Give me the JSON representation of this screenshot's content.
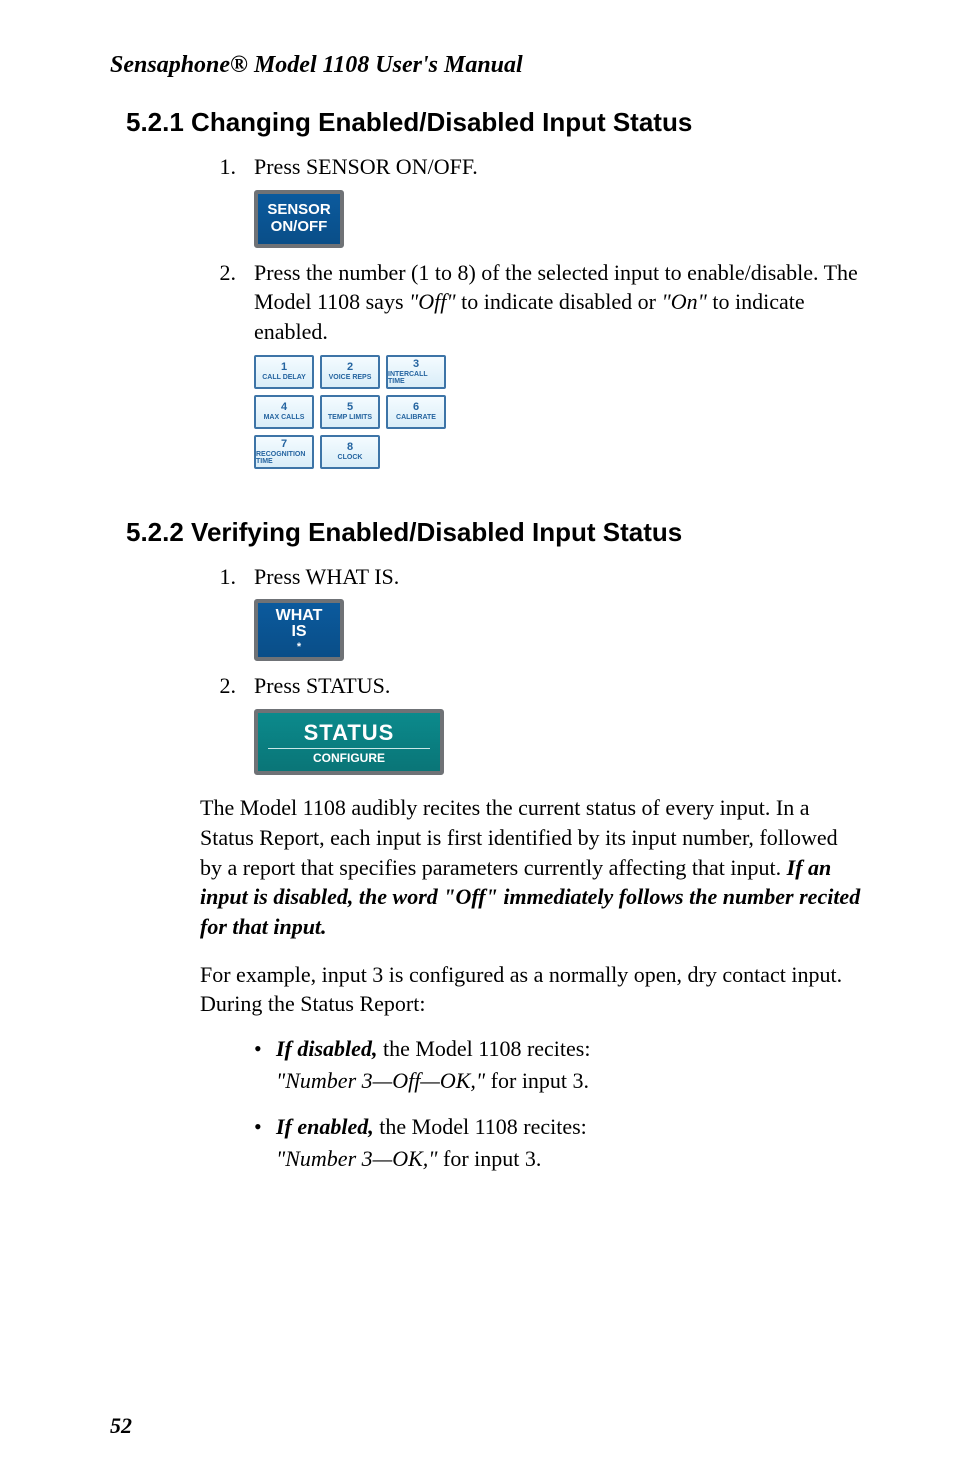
{
  "header": "Sensaphone® Model 1108 User's Manual",
  "section521": {
    "heading": "5.2.1  Changing Enabled/Disabled Input Status",
    "step1_num": "1.",
    "step1_text": "Press SENSOR ON/OFF.",
    "sensor_btn_line1": "SENSOR",
    "sensor_btn_line2": "ON/OFF",
    "step2_num": "2.",
    "step2_a": "Press the number (1 to 8) of the selected input to enable/disable. The Model 1108 says ",
    "step2_off": "\"Off\"",
    "step2_b": " to indicate disabled or ",
    "step2_on": "\"On\"",
    "step2_c": " to indicate enabled.",
    "keypad": [
      [
        {
          "n": "1",
          "l": "CALL DELAY"
        },
        {
          "n": "2",
          "l": "VOICE REPS"
        },
        {
          "n": "3",
          "l": "INTERCALL TIME"
        }
      ],
      [
        {
          "n": "4",
          "l": "MAX CALLS"
        },
        {
          "n": "5",
          "l": "TEMP LIMITS"
        },
        {
          "n": "6",
          "l": "CALIBRATE"
        }
      ],
      [
        {
          "n": "7",
          "l": "RECOGNITION TIME"
        },
        {
          "n": "8",
          "l": "CLOCK"
        }
      ]
    ]
  },
  "section522": {
    "heading": "5.2.2  Verifying Enabled/Disabled Input Status",
    "step1_num": "1.",
    "step1_text": "Press WHAT IS.",
    "whatis_line1": "WHAT",
    "whatis_line2": "IS",
    "whatis_star": "*",
    "step2_num": "2.",
    "step2_text": "Press STATUS.",
    "status_main": "STATUS",
    "status_sub": "CONFIGURE",
    "para1_a": "The Model 1108 audibly recites the current status of every input. In a Status Report, each input is first identified by its input number, followed by a report that specifies parameters currently affecting that input. ",
    "para1_b": "If an input is disabled, the word \"Off\" immediately follows the number recited for that input.",
    "para2": "For example, input 3 is configured as a normally open, dry contact input. During the Status Report:",
    "bullet1_a": "If disabled,",
    "bullet1_b": " the Model 1108 recites:",
    "bullet1_c": "\"Number 3—Off—OK,\"",
    "bullet1_d": " for input 3.",
    "bullet2_a": "If enabled,",
    "bullet2_b": " the Model 1108 recites:",
    "bullet2_c": "\"Number 3—OK,\"",
    "bullet2_d": " for input 3."
  },
  "page_number": "52"
}
